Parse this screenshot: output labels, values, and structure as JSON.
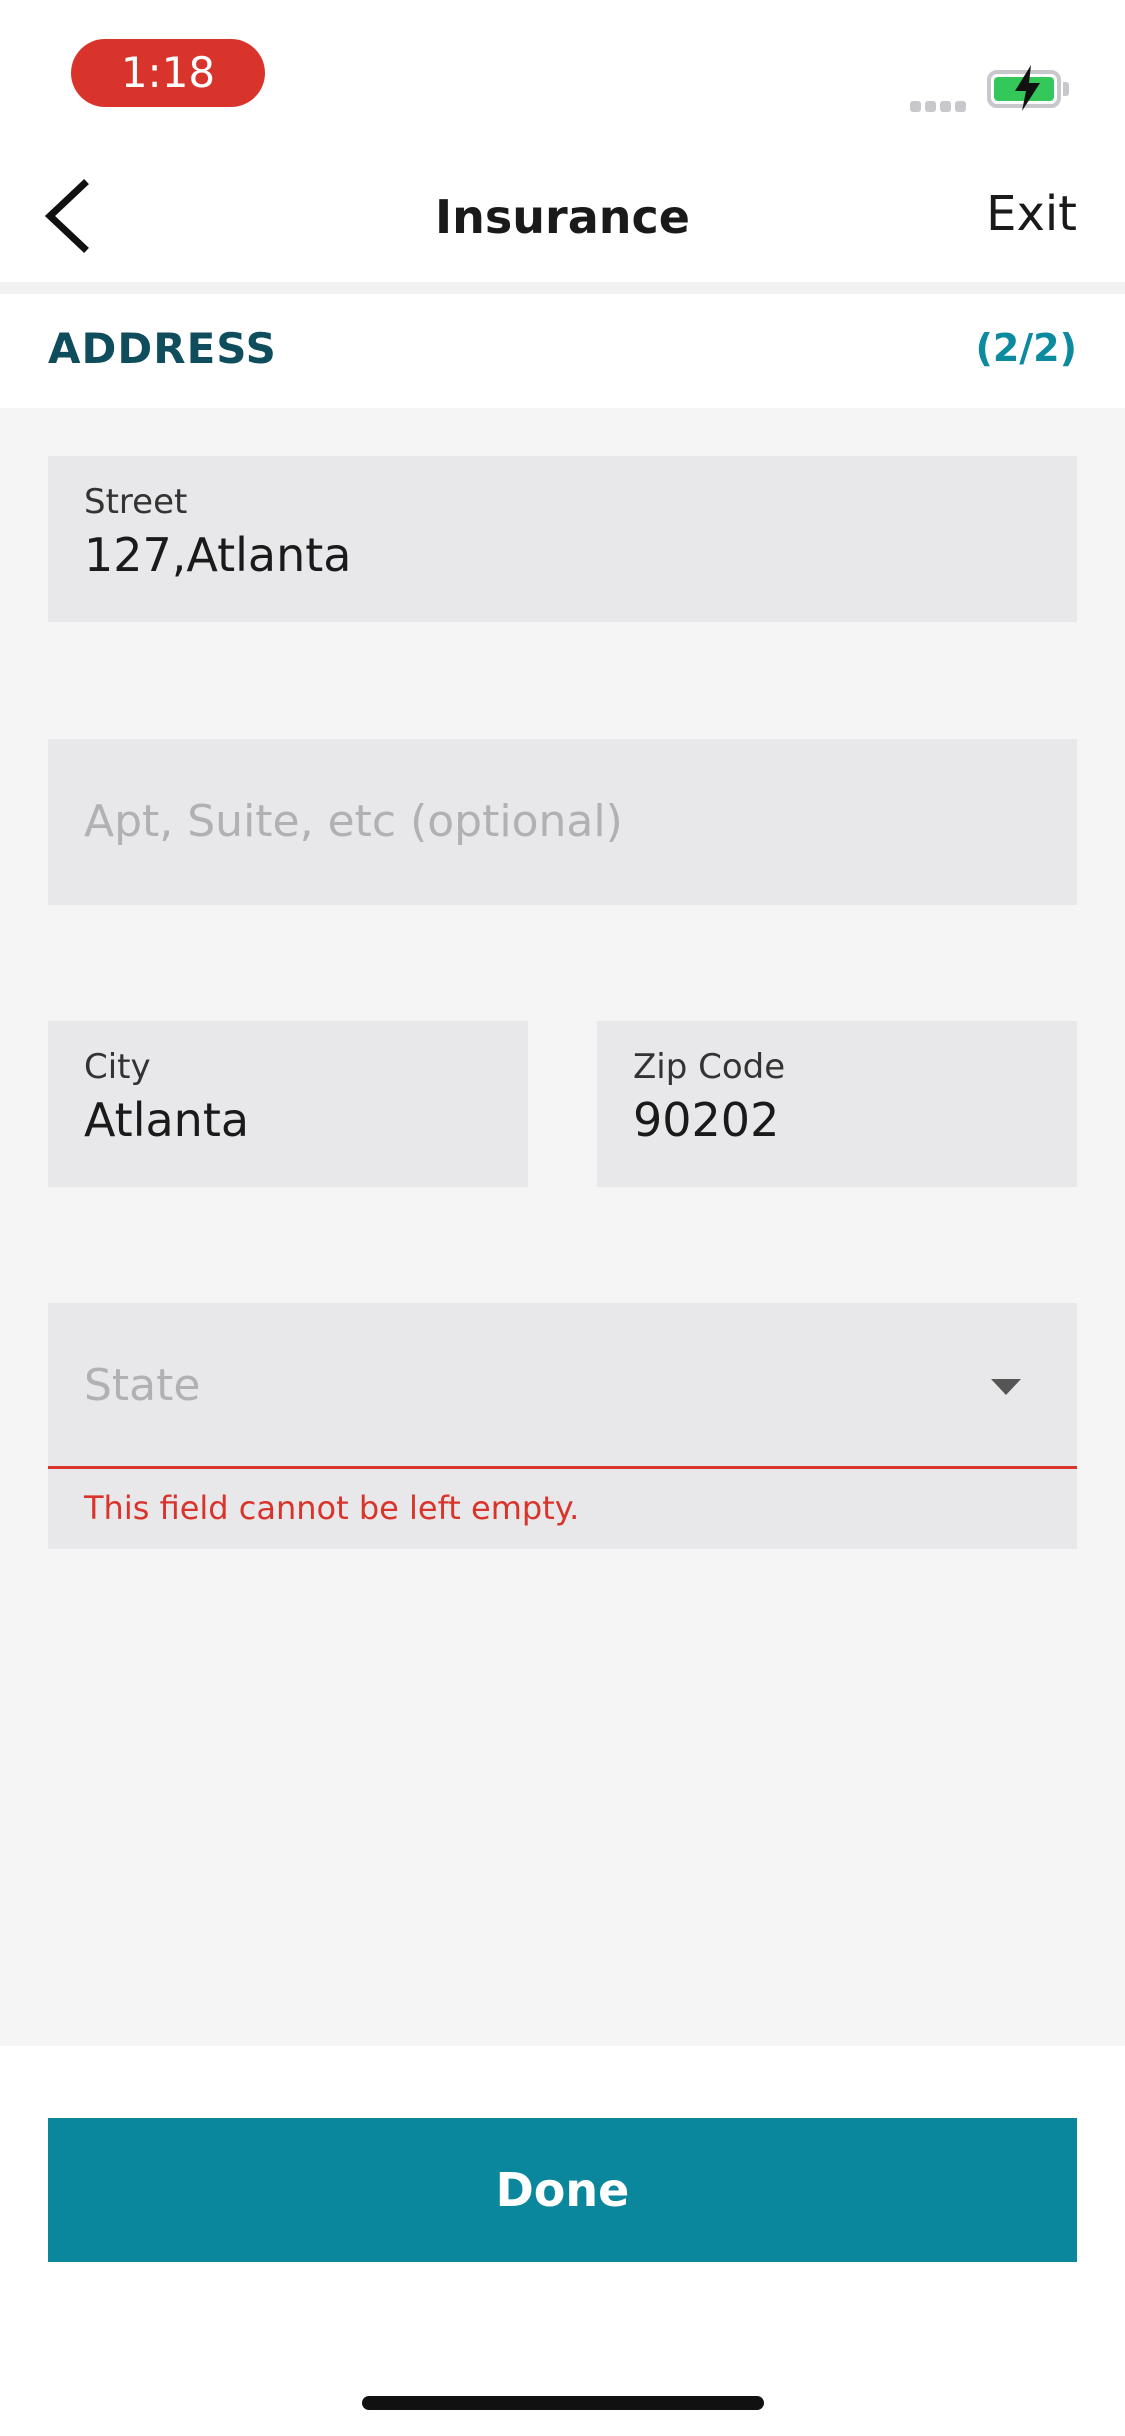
{
  "status_bar": {
    "time": "1:18",
    "battery_icon": "battery-charging-icon",
    "signal_icon": "signal-icon",
    "time_pill_color": "#d9342b"
  },
  "nav": {
    "title": "Insurance",
    "exit_label": "Exit",
    "back_icon": "chevron-left-icon"
  },
  "section": {
    "title": "ADDRESS",
    "step": "(2/2)",
    "title_color": "#0f4d5c",
    "step_color": "#0b8aa0"
  },
  "form": {
    "street": {
      "label": "Street",
      "value": "127,Atlanta"
    },
    "apt": {
      "placeholder": "Apt, Suite, etc (optional)"
    },
    "city": {
      "label": "City",
      "value": "Atlanta"
    },
    "zip": {
      "label": "Zip Code",
      "value": "90202"
    },
    "state": {
      "placeholder": "State",
      "error": "This field cannot be left empty.",
      "arrow_icon": "caret-down-icon"
    }
  },
  "actions": {
    "done_label": "Done",
    "done_color": "#0b879d"
  }
}
